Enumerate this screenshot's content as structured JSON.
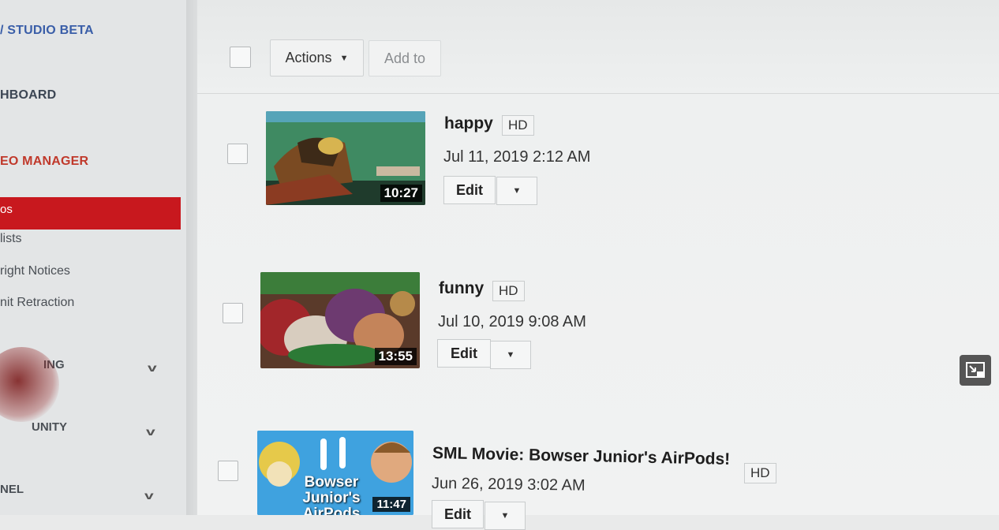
{
  "sidebar": {
    "studio_title": "/ STUDIO BETA",
    "dashboard": "HBOARD",
    "video_manager": "EO MANAGER",
    "items": [
      {
        "label": "os",
        "active": true
      },
      {
        "label": "lists"
      },
      {
        "label": "right Notices"
      },
      {
        "label": "nit Retraction"
      }
    ],
    "collapsed_sections": [
      {
        "label": "ING"
      },
      {
        "label": "UNITY"
      },
      {
        "label": "NEL"
      }
    ]
  },
  "toolbar": {
    "actions_label": "Actions",
    "add_to_label": "Add to"
  },
  "videos": [
    {
      "title": "happy",
      "quality": "HD",
      "date": "Jul 11, 2019 2:12 AM",
      "duration": "10:27",
      "edit_label": "Edit"
    },
    {
      "title": "funny",
      "quality": "HD",
      "date": "Jul 10, 2019 9:08 AM",
      "duration": "13:55",
      "edit_label": "Edit"
    },
    {
      "title": "SML Movie: Bowser Junior's AirPods!",
      "quality": "HD",
      "date": "Jun 26, 2019 3:02 AM",
      "duration": "11:47",
      "edit_label": "Edit",
      "thumb_text": "Bowser Junior's AirPods"
    }
  ],
  "icons": {
    "caret": "caret-down-icon",
    "chevron": "chevron-down-icon",
    "pip": "picture-in-picture-icon"
  },
  "colors": {
    "sidebar_active": "#c8181e",
    "studio_title": "#3a5ea8",
    "video_manager": "#c0392b"
  }
}
